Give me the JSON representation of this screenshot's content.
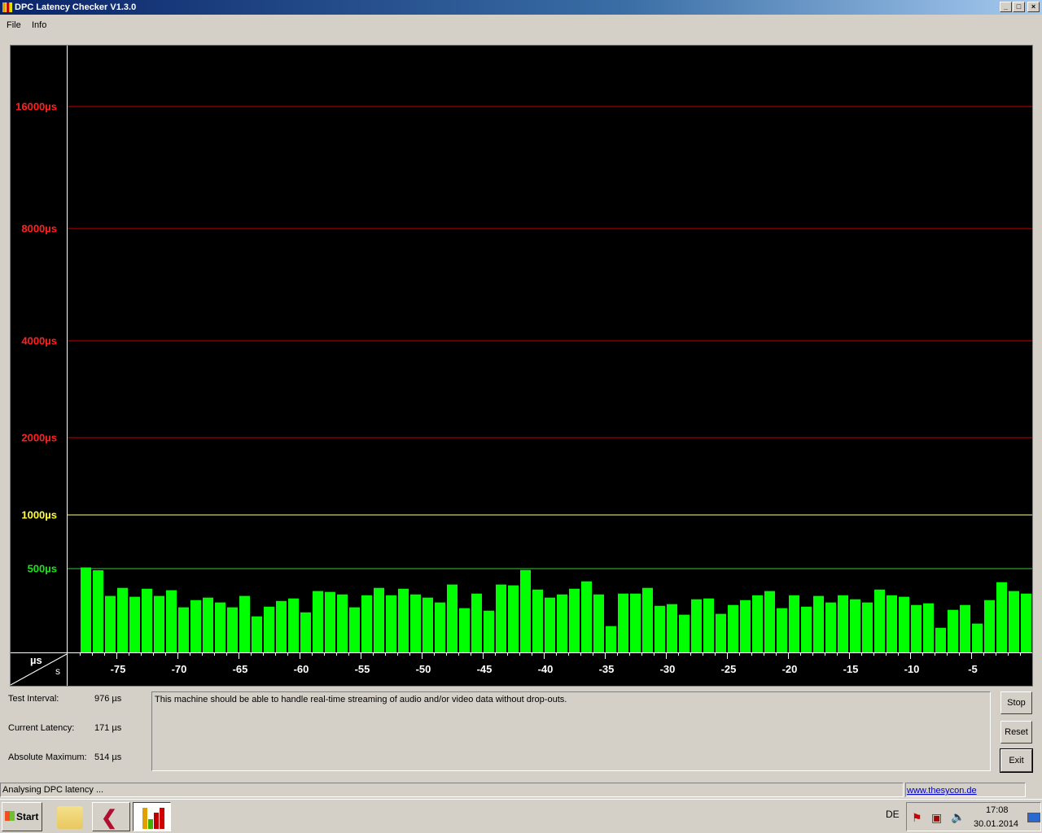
{
  "window": {
    "title": "DPC Latency Checker V1.3.0"
  },
  "menu": [
    {
      "label": "File"
    },
    {
      "label": "Info"
    }
  ],
  "colors": {
    "bar": "#00ff00",
    "red_line": "#cc0000",
    "yellow_line": "#ffff80",
    "green_line": "#40c040",
    "red_label": "#ff2020",
    "yellow_label": "#ffff40",
    "green_label": "#20e020"
  },
  "chart_data": {
    "type": "bar",
    "xlabel": "s",
    "ylabel": "µs",
    "y_ticks": [
      {
        "value": 16000,
        "label": "16000µs",
        "color": "red"
      },
      {
        "value": 8000,
        "label": "8000µs",
        "color": "red"
      },
      {
        "value": 4000,
        "label": "4000µs",
        "color": "red"
      },
      {
        "value": 2000,
        "label": "2000µs",
        "color": "red"
      },
      {
        "value": 1000,
        "label": "1000µs",
        "color": "yellow"
      },
      {
        "value": 500,
        "label": "500µs",
        "color": "green"
      }
    ],
    "x_ticks": [
      "-75",
      "-70",
      "-65",
      "-60",
      "-55",
      "-50",
      "-45",
      "-40",
      "-35",
      "-30",
      "-25",
      "-20",
      "-15",
      "-10",
      "-5"
    ],
    "x_tick_values": [
      -75,
      -70,
      -65,
      -60,
      -55,
      -50,
      -45,
      -40,
      -35,
      -30,
      -25,
      -20,
      -15,
      -10,
      -5
    ],
    "xlim": [
      -78,
      0
    ],
    "values": [
      511,
      490,
      337,
      385,
      332,
      380,
      337,
      371,
      269,
      312,
      327,
      298,
      269,
      337,
      215,
      273,
      307,
      322,
      239,
      366,
      361,
      346,
      269,
      341,
      385,
      341,
      380,
      346,
      327,
      298,
      405,
      264,
      351,
      249,
      405,
      400,
      492,
      375,
      327,
      346,
      380,
      424,
      346,
      157,
      351,
      351,
      385,
      278,
      288,
      225,
      317,
      322,
      230,
      283,
      312,
      341,
      366,
      264,
      341,
      273,
      337,
      298,
      341,
      317,
      298,
      375,
      341,
      332,
      283,
      293,
      147,
      254,
      283,
      172,
      312,
      419,
      366,
      351
    ]
  },
  "info": {
    "test_interval_label": "Test Interval:",
    "test_interval_value": "976 µs",
    "current_latency_label": "Current Latency:",
    "current_latency_value": "171 µs",
    "absolute_maximum_label": "Absolute Maximum:",
    "absolute_maximum_value": "514 µs",
    "message": "This machine should be able to handle real-time streaming of audio and/or video data without drop-outs."
  },
  "buttons": {
    "stop": "Stop",
    "reset": "Reset",
    "exit": "Exit"
  },
  "status": {
    "text": "Analysing DPC latency ...",
    "link": "www.thesycon.de"
  },
  "taskbar": {
    "start": "Start",
    "language": "DE",
    "time": "17:08",
    "date": "30.01.2014"
  }
}
